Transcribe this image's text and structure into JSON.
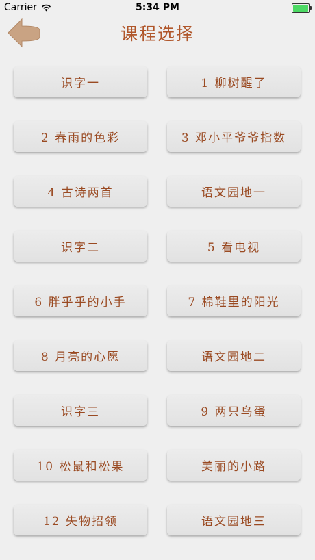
{
  "status_bar": {
    "carrier": "Carrier",
    "time": "5:34 PM"
  },
  "header": {
    "title": "课程选择"
  },
  "lessons": [
    "识字一",
    "1 柳树醒了",
    "2 春雨的色彩",
    "3 邓小平爷爷指数",
    "4 古诗两首",
    "语文园地一",
    "识字二",
    "5 看电视",
    "6 胖乎乎的小手",
    "7 棉鞋里的阳光",
    "8 月亮的心愿",
    "语文园地二",
    "识字三",
    "9 两只鸟蛋",
    "10 松鼠和松果",
    "美丽的小路",
    "12 失物招领",
    "语文园地三"
  ],
  "colors": {
    "accent": "#b0562a",
    "button_text": "#9a4a22",
    "back_arrow": "#c9a383",
    "background": "#efefef"
  },
  "icons": {
    "back": "back-arrow-icon",
    "wifi": "wifi-icon",
    "battery": "battery-icon"
  }
}
